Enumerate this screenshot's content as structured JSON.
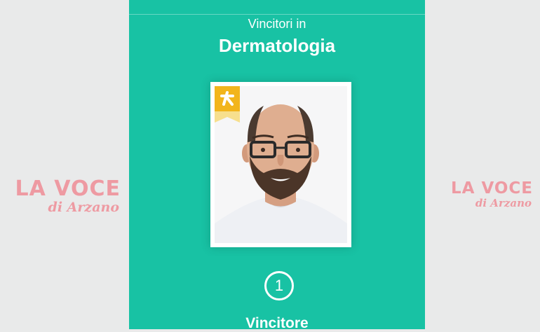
{
  "header": {
    "subtitle": "Vincitori in",
    "title": "Dermatologia"
  },
  "winner": {
    "rank": "1",
    "rank_label": "Vincitore",
    "badge_icon": "star-award-icon"
  },
  "watermark": {
    "name": "LA VOCE",
    "tagline": "di Arzano"
  },
  "colors": {
    "card_bg": "#18c2a4",
    "side_bg": "#e9eaea",
    "badge": "#f2b51c",
    "logo": "#ee9aa2"
  }
}
